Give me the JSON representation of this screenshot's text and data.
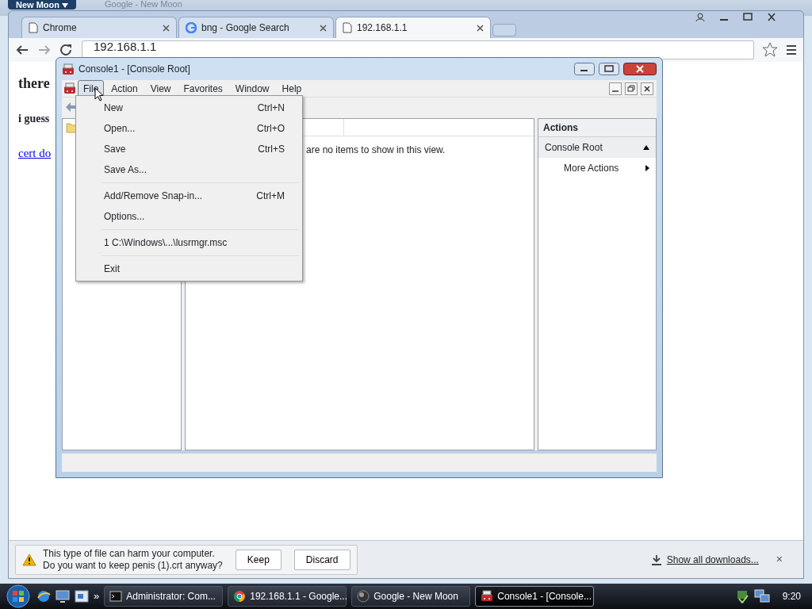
{
  "background_window": {
    "button": "New Moon",
    "title": "Google - New Moon"
  },
  "browser": {
    "tabs": [
      {
        "label": "Chrome",
        "selected": false
      },
      {
        "label": "bng - Google Search",
        "selected": false
      },
      {
        "label": "192.168.1.1",
        "selected": true
      }
    ],
    "address": "192.168.1.1",
    "page": {
      "heading": "there",
      "bold_line": "i guess",
      "link": "cert do"
    },
    "download_bar": {
      "warning": [
        "This type of file can harm your computer.",
        "Do you want to keep penis (1).crt anyway?"
      ],
      "buttons": [
        "Keep",
        "Discard"
      ],
      "show_all": "Show all downloads...",
      "close": "×"
    }
  },
  "console": {
    "title": "Console1 - [Console Root]",
    "menu": [
      {
        "label": "File",
        "selected": true
      },
      {
        "label": "Action",
        "selected": false
      },
      {
        "label": "View",
        "selected": false
      },
      {
        "label": "Favorites",
        "selected": false
      },
      {
        "label": "Window",
        "selected": false
      },
      {
        "label": "Help",
        "selected": false
      }
    ],
    "file_menu": [
      [
        {
          "label": "New",
          "shortcut": "Ctrl+N"
        },
        {
          "label": "Open...",
          "shortcut": "Ctrl+O"
        },
        {
          "label": "Save",
          "shortcut": "Ctrl+S"
        },
        {
          "label": "Save As..."
        }
      ],
      [
        {
          "label": "Add/Remove Snap-in...",
          "shortcut": "Ctrl+M"
        },
        {
          "label": "Options..."
        }
      ],
      [
        {
          "label": "1 C:\\Windows\\...\\lusrmgr.msc"
        }
      ],
      [
        {
          "label": "Exit"
        }
      ]
    ],
    "message": "are no items to show in this view.",
    "actions": {
      "header": "Actions",
      "items": [
        {
          "label": "Console Root",
          "kind": "section",
          "expanded": true
        },
        {
          "label": "More Actions",
          "kind": "submenu"
        }
      ]
    }
  },
  "taskbar": {
    "overflow": "»",
    "tasks": [
      {
        "label": "Administrator: Com...",
        "selected": false
      },
      {
        "label": "192.168.1.1 - Google...",
        "selected": false
      },
      {
        "label": "Google - New Moon",
        "selected": false
      },
      {
        "label": "Console1 - [Console...",
        "selected": true
      }
    ],
    "clock": "9:20"
  }
}
